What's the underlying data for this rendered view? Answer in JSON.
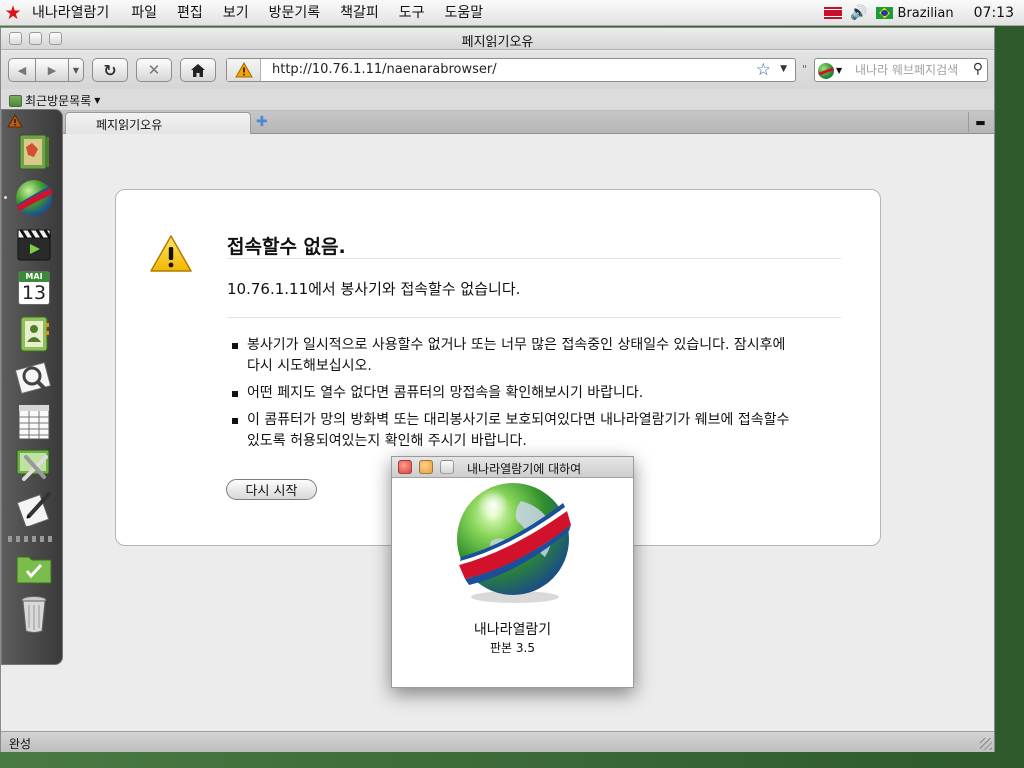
{
  "menubar": {
    "app_name": "내나라열람기",
    "items": [
      "파일",
      "편집",
      "보기",
      "방문기록",
      "책갈피",
      "도구",
      "도움말"
    ],
    "language": "Brazilian",
    "clock": "07:13"
  },
  "window": {
    "title": "페지읽기오유"
  },
  "toolbar": {
    "url": "http://10.76.1.11/naenarabrowser/",
    "search_placeholder": "내나라 웨브페지검색"
  },
  "bookmarks": {
    "recent_label": "최근방문목록"
  },
  "tabs": [
    {
      "label": "페지읽기오유"
    }
  ],
  "error": {
    "title": "접속할수 없음.",
    "description": "10.76.1.11에서 봉사기와 접속할수 없습니다.",
    "bullets": [
      "봉사기가 일시적으로 사용할수 없거나 또는 너무 많은 접속중인 상태일수 있습니다. 잠시후에 다시 시도해보십시오.",
      "어떤 페지도 열수 없다면 콤퓨터의 망접속을 확인해보시기 바랍니다.",
      "이 콤퓨터가 망의 방화벽 또는 대리봉사기로 보호되여있다면 내나라열람기가 웨브에 접속할수 있도록 허용되여있는지 확인해 주시기 바랍니다."
    ],
    "retry_label": "다시 시작"
  },
  "dock": {
    "calendar_month": "MAI",
    "calendar_day": "13"
  },
  "about": {
    "title": "내나라열람기에 대하여",
    "name": "내나라열람기",
    "version": "판본 3.5"
  },
  "status": {
    "text": "완성"
  },
  "colors": {
    "accent": "#2b5fa5",
    "warning": "#f4c800",
    "close_red": "#e0443e",
    "minimize_orange": "#e8a23a"
  }
}
